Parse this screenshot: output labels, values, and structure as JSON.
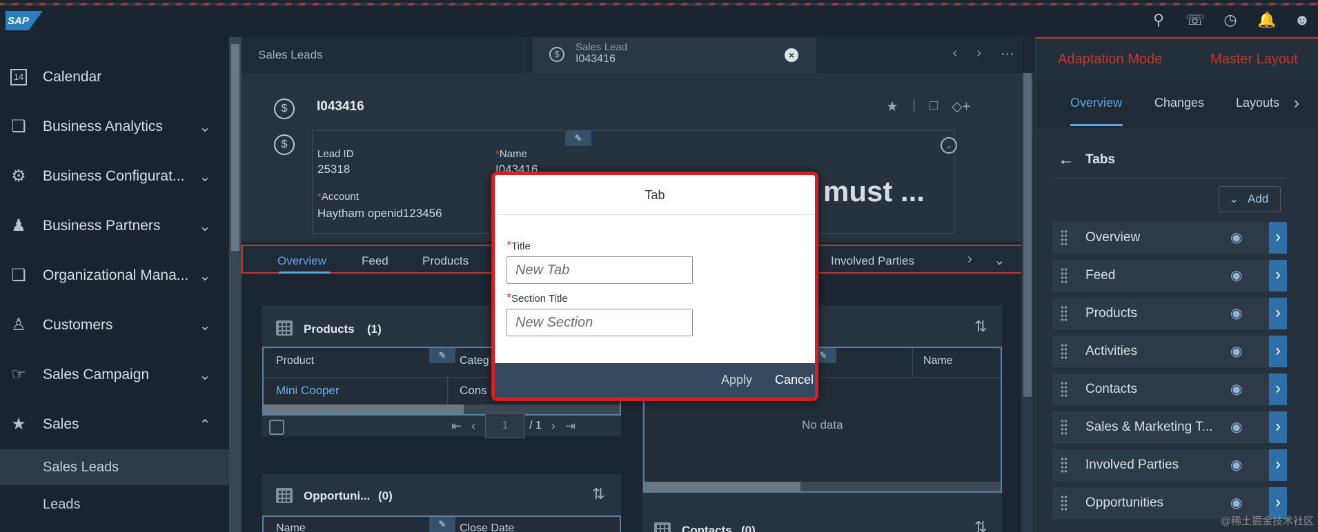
{
  "shell": {
    "logo": "SAP",
    "icons": [
      "search-icon",
      "chat-icon",
      "history-icon",
      "bell-icon",
      "user-icon"
    ]
  },
  "sidebar": {
    "items": [
      {
        "label": "Calendar",
        "icon": "calendar-icon"
      },
      {
        "label": "Business Analytics",
        "icon": "copy-icon"
      },
      {
        "label": "Business Configurat...",
        "icon": "config-icon"
      },
      {
        "label": "Business Partners",
        "icon": "partners-icon"
      },
      {
        "label": "Organizational Mana...",
        "icon": "org-icon"
      },
      {
        "label": "Customers",
        "icon": "customers-icon"
      },
      {
        "label": "Sales Campaign",
        "icon": "megaphone-icon"
      },
      {
        "label": "Sales",
        "icon": "sales-icon"
      }
    ],
    "calendar_day": "14",
    "sub_items": [
      "Sales Leads",
      "Leads"
    ]
  },
  "tabs": {
    "tab1": "Sales Leads",
    "tab2_line1": "Sales Lead",
    "tab2_line2": "I043416"
  },
  "header": {
    "title": "I043416",
    "lead_id_label": "Lead ID",
    "lead_id_value": "25318",
    "name_label": "Name",
    "name_value": "I043416",
    "account_label": "Account",
    "account_value": "Haytham openid123456",
    "overlay_text": "must ..."
  },
  "object_tabs": [
    "Overview",
    "Feed",
    "Products",
    "Involved Parties"
  ],
  "products_card": {
    "title": "Products",
    "count": "(1)",
    "col_product": "Product",
    "col_category": "Categ",
    "row_product": "Mini Cooper",
    "row_category": "Cons",
    "page": "1",
    "page_total": "/ 1"
  },
  "right_card": {
    "col_name": "Name",
    "nodata": "No data"
  },
  "opportunities_card": {
    "title": "Opportuni...",
    "count": "(0)",
    "col_name": "Name",
    "col_close": "Close Date"
  },
  "contacts_card": {
    "title": "Contacts",
    "count": "(0)"
  },
  "modal": {
    "title": "Tab",
    "title_label": "Title",
    "title_placeholder": "New Tab",
    "section_label": "Section Title",
    "section_placeholder": "New Section",
    "apply": "Apply",
    "cancel": "Cancel"
  },
  "panel": {
    "adaptation_mode": "Adaptation Mode",
    "master_layout": "Master Layout",
    "tabs": [
      "Overview",
      "Changes",
      "Layouts"
    ],
    "section_title": "Tabs",
    "add_label": "Add",
    "rows": [
      "Overview",
      "Feed",
      "Products",
      "Activities",
      "Contacts",
      "Sales & Marketing T...",
      "Involved Parties",
      "Opportunities"
    ]
  },
  "watermark": "@稀土掘金技术社区",
  "colors": {
    "accent": "#5aa5e8",
    "adaptation_red": "#c0392b",
    "modal_border": "#d42020",
    "footer": "#354a5f"
  }
}
